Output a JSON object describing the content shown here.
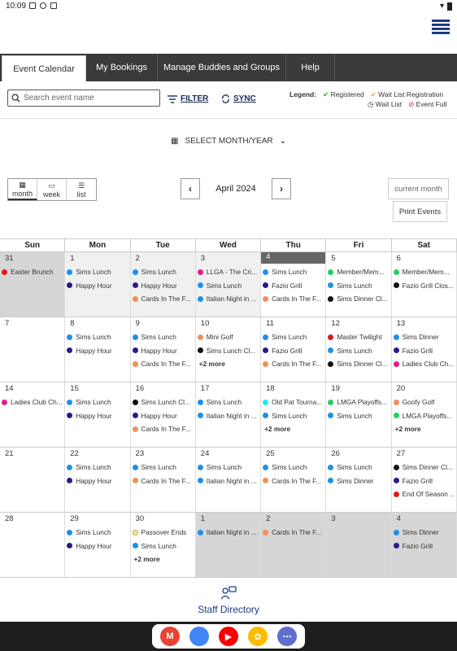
{
  "status": {
    "time": "10:09"
  },
  "tabs": [
    {
      "label": "Event Calendar"
    },
    {
      "label": "My Bookings"
    },
    {
      "label": "Manage Buddies and Groups"
    },
    {
      "label": "Help"
    }
  ],
  "search": {
    "placeholder": "Search event name"
  },
  "toolbar": {
    "filter_label": "FILTER",
    "sync_label": "SYNC"
  },
  "legend": {
    "title": "Legend:",
    "registered": "Registered",
    "waitlist_registration": "Wait List Registration",
    "waitlist": "Wait List",
    "event_full": "Event Full"
  },
  "select_month": "SELECT MONTH/YEAR",
  "views": {
    "month": "month",
    "week": "week",
    "list": "list"
  },
  "month_label": "April 2024",
  "current_month": "current month",
  "print_events": "Print Events",
  "dow": [
    "Sun",
    "Mon",
    "Tue",
    "Wed",
    "Thu",
    "Fri",
    "Sat"
  ],
  "colors": {
    "blue": "#1e90e8",
    "navy": "#2a1a8a",
    "orange": "#f0905a",
    "red": "#e01818",
    "green": "#22d060",
    "black": "#111111",
    "pink": "#e81a8a",
    "cyan": "#22e8f0",
    "yellow": "#f5e8a0"
  },
  "weeks": [
    [
      {
        "day": "31",
        "style": "grey",
        "events": [
          {
            "t": "Easter Brunch",
            "c": "red"
          }
        ]
      },
      {
        "day": "1",
        "style": "other",
        "events": [
          {
            "t": "Sims Lunch",
            "c": "blue"
          },
          {
            "t": "Happy Hour",
            "c": "navy"
          }
        ]
      },
      {
        "day": "2",
        "style": "other",
        "events": [
          {
            "t": "Sims Lunch",
            "c": "blue"
          },
          {
            "t": "Happy Hour",
            "c": "navy"
          },
          {
            "t": "Cards In The F...",
            "c": "orange"
          }
        ]
      },
      {
        "day": "3",
        "style": "other",
        "events": [
          {
            "t": "LLGA - The Cri...",
            "c": "pink"
          },
          {
            "t": "Sims Lunch",
            "c": "blue"
          },
          {
            "t": "Italian Night in ...",
            "c": "blue"
          }
        ]
      },
      {
        "day": "4",
        "style": "today",
        "events": [
          {
            "t": "Sims Lunch",
            "c": "blue"
          },
          {
            "t": "Fazio Grill",
            "c": "navy"
          },
          {
            "t": "Cards In The F...",
            "c": "orange"
          }
        ]
      },
      {
        "day": "5",
        "style": "",
        "events": [
          {
            "t": "Member/Mem...",
            "c": "green"
          },
          {
            "t": "Sims Lunch",
            "c": "blue"
          },
          {
            "t": "Sims Dinner Cl...",
            "c": "black"
          }
        ]
      },
      {
        "day": "6",
        "style": "",
        "events": [
          {
            "t": "Member/Mem...",
            "c": "green"
          },
          {
            "t": "Fazio Grill Clos...",
            "c": "black"
          }
        ]
      }
    ],
    [
      {
        "day": "7",
        "style": "",
        "events": []
      },
      {
        "day": "8",
        "style": "",
        "events": [
          {
            "t": "Sims Lunch",
            "c": "blue"
          },
          {
            "t": "Happy Hour",
            "c": "navy"
          }
        ]
      },
      {
        "day": "9",
        "style": "",
        "events": [
          {
            "t": "Sims Lunch",
            "c": "blue"
          },
          {
            "t": "Happy Hour",
            "c": "navy"
          },
          {
            "t": "Cards In The F...",
            "c": "orange"
          }
        ]
      },
      {
        "day": "10",
        "style": "",
        "events": [
          {
            "t": "Mini Golf",
            "c": "orange"
          },
          {
            "t": "Sims Lunch Cl...",
            "c": "black"
          }
        ],
        "more": "+2 more"
      },
      {
        "day": "11",
        "style": "",
        "events": [
          {
            "t": "Sims Lunch",
            "c": "blue"
          },
          {
            "t": "Fazio Grill",
            "c": "navy"
          },
          {
            "t": "Cards In The F...",
            "c": "orange"
          }
        ]
      },
      {
        "day": "12",
        "style": "",
        "events": [
          {
            "t": "Master Twilight",
            "c": "red"
          },
          {
            "t": "Sims Lunch",
            "c": "blue"
          },
          {
            "t": "Sims Dinner Cl...",
            "c": "black"
          }
        ]
      },
      {
        "day": "13",
        "style": "",
        "events": [
          {
            "t": "Sims Dinner",
            "c": "blue"
          },
          {
            "t": "Fazio Grill",
            "c": "navy"
          },
          {
            "t": "Ladies Club Ch...",
            "c": "pink"
          }
        ]
      }
    ],
    [
      {
        "day": "14",
        "style": "",
        "events": [
          {
            "t": "Ladies Club Ch...",
            "c": "pink"
          }
        ]
      },
      {
        "day": "15",
        "style": "",
        "events": [
          {
            "t": "Sims Lunch",
            "c": "blue"
          },
          {
            "t": "Happy Hour",
            "c": "navy"
          }
        ]
      },
      {
        "day": "16",
        "style": "",
        "events": [
          {
            "t": "Sims Lunch Cl...",
            "c": "black"
          },
          {
            "t": "Happy Hour",
            "c": "navy"
          },
          {
            "t": "Cards In The F...",
            "c": "orange"
          }
        ]
      },
      {
        "day": "17",
        "style": "",
        "events": [
          {
            "t": "Sims Lunch",
            "c": "blue"
          },
          {
            "t": "Italian Night in ...",
            "c": "blue"
          }
        ]
      },
      {
        "day": "18",
        "style": "",
        "events": [
          {
            "t": "Old Pat Tourna...",
            "c": "cyan"
          },
          {
            "t": "Sims Lunch",
            "c": "blue"
          }
        ],
        "more": "+2 more"
      },
      {
        "day": "19",
        "style": "",
        "events": [
          {
            "t": "LMGA Playoffs...",
            "c": "green"
          },
          {
            "t": "Sims Lunch",
            "c": "blue"
          }
        ]
      },
      {
        "day": "20",
        "style": "",
        "events": [
          {
            "t": "Goofy Golf",
            "c": "orange"
          },
          {
            "t": "LMGA Playoffs...",
            "c": "green"
          }
        ],
        "more": "+2 more"
      }
    ],
    [
      {
        "day": "21",
        "style": "",
        "events": []
      },
      {
        "day": "22",
        "style": "",
        "events": [
          {
            "t": "Sims Lunch",
            "c": "blue"
          },
          {
            "t": "Happy Hour",
            "c": "navy"
          }
        ]
      },
      {
        "day": "23",
        "style": "",
        "events": [
          {
            "t": "Sims Lunch",
            "c": "blue"
          },
          {
            "t": "Cards In The F...",
            "c": "orange"
          }
        ]
      },
      {
        "day": "24",
        "style": "",
        "events": [
          {
            "t": "Sims Lunch",
            "c": "blue"
          },
          {
            "t": "Italian Night in ...",
            "c": "blue"
          }
        ]
      },
      {
        "day": "25",
        "style": "",
        "events": [
          {
            "t": "Sims Lunch",
            "c": "blue"
          },
          {
            "t": "Cards In The F...",
            "c": "orange"
          }
        ]
      },
      {
        "day": "26",
        "style": "",
        "events": [
          {
            "t": "Sims Lunch",
            "c": "blue"
          },
          {
            "t": "Sims Dinner",
            "c": "blue"
          }
        ]
      },
      {
        "day": "27",
        "style": "",
        "events": [
          {
            "t": "Sims Dinner Cl...",
            "c": "black"
          },
          {
            "t": "Fazio Grill",
            "c": "navy"
          },
          {
            "t": "End Of Season ...",
            "c": "red"
          }
        ]
      }
    ],
    [
      {
        "day": "28",
        "style": "",
        "events": []
      },
      {
        "day": "29",
        "style": "",
        "events": [
          {
            "t": "Sims Lunch",
            "c": "blue"
          },
          {
            "t": "Happy Hour",
            "c": "navy"
          }
        ]
      },
      {
        "day": "30",
        "style": "",
        "events": [
          {
            "t": "Passover Ends",
            "c": "yellow"
          },
          {
            "t": "Sims Lunch",
            "c": "blue"
          }
        ],
        "more": "+2 more"
      },
      {
        "day": "1",
        "style": "grey",
        "events": [
          {
            "t": "Italian Night in ...",
            "c": "blue"
          }
        ]
      },
      {
        "day": "2",
        "style": "grey",
        "events": [
          {
            "t": "Cards In The F...",
            "c": "orange"
          }
        ]
      },
      {
        "day": "3",
        "style": "grey",
        "events": []
      },
      {
        "day": "4",
        "style": "grey",
        "events": [
          {
            "t": "Sims Dinner",
            "c": "blue"
          },
          {
            "t": "Fazio Grill",
            "c": "navy"
          }
        ]
      }
    ]
  ],
  "staff_directory": "Staff Directory",
  "dock": [
    {
      "name": "gmail",
      "letter": "M",
      "color": "#ea4335"
    },
    {
      "name": "chrome",
      "letter": "",
      "color": "#4285f4"
    },
    {
      "name": "youtube",
      "letter": "▶",
      "color": "#ff0000"
    },
    {
      "name": "photos",
      "letter": "✿",
      "color": "#fbbc04"
    },
    {
      "name": "apps",
      "letter": "⋯",
      "color": "#5f6fcf"
    }
  ]
}
